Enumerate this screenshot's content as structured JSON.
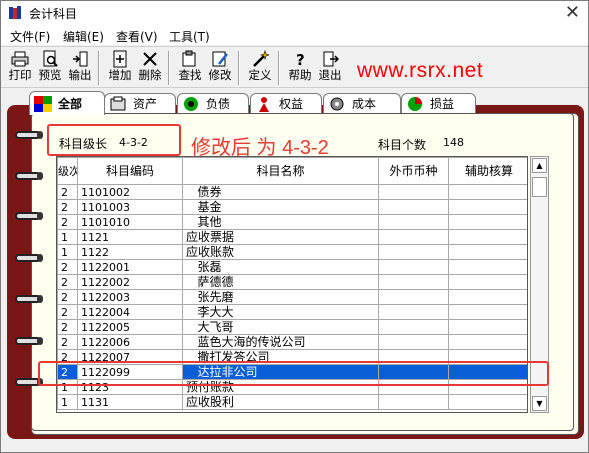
{
  "window": {
    "title": "会计科目"
  },
  "menu": [
    "文件(F)",
    "编辑(E)",
    "查看(V)",
    "工具(T)"
  ],
  "toolbar": {
    "print": "打印",
    "preview": "预览",
    "export": "输出",
    "add": "增加",
    "delete": "删除",
    "find": "查找",
    "modify": "修改",
    "define": "定义",
    "help": "帮助",
    "exit": "退出"
  },
  "watermark": "www.rsrx.net",
  "tabs": [
    "全部",
    "资产",
    "负债",
    "权益",
    "成本",
    "损益"
  ],
  "info": {
    "level_label": "科目级长",
    "level_value": "4-3-2",
    "count_label": "科目个数",
    "count_value": "148",
    "annotation": "修改后 为 4-3-2"
  },
  "table": {
    "headers": {
      "level": "级次",
      "code": "科目编码",
      "name": "科目名称",
      "currency": "外币币种",
      "aux": "辅助核算"
    },
    "rows": [
      {
        "level": "2",
        "code": "1101002",
        "name": "   债券"
      },
      {
        "level": "2",
        "code": "1101003",
        "name": "   基金"
      },
      {
        "level": "2",
        "code": "1101010",
        "name": "   其他"
      },
      {
        "level": "1",
        "code": "1121",
        "name": "应收票据"
      },
      {
        "level": "1",
        "code": "1122",
        "name": "应收账款"
      },
      {
        "level": "2",
        "code": "1122001",
        "name": "   张磊"
      },
      {
        "level": "2",
        "code": "1122002",
        "name": "   萨德德"
      },
      {
        "level": "2",
        "code": "1122003",
        "name": "   张先磨"
      },
      {
        "level": "2",
        "code": "1122004",
        "name": "   李大大"
      },
      {
        "level": "2",
        "code": "1122005",
        "name": "   大飞哥"
      },
      {
        "level": "2",
        "code": "1122006",
        "name": "   蓝色大海的传说公司"
      },
      {
        "level": "2",
        "code": "1122007",
        "name": "   撒打发答公司"
      },
      {
        "level": "2",
        "code": "1122099",
        "name": "   达拉非公司"
      },
      {
        "level": "1",
        "code": "1123",
        "name": "预付账款"
      },
      {
        "level": "1",
        "code": "1131",
        "name": "应收股利"
      }
    ]
  },
  "colors": {
    "accent_red": "#e53935",
    "selection": "#0a5fd6",
    "binder": "#7b1616"
  }
}
